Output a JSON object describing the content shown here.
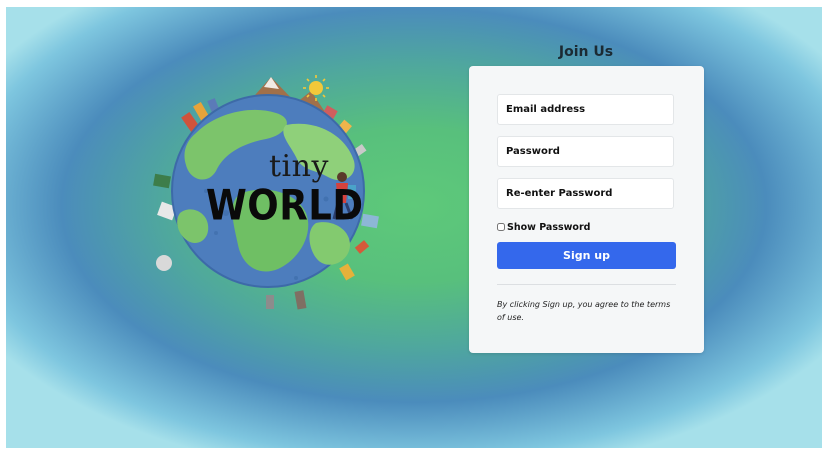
{
  "brand": {
    "line1": "tiny",
    "line2": "WORLD"
  },
  "signup": {
    "title": "Join Us",
    "email_placeholder": "Email address",
    "password_placeholder": "Password",
    "reenter_placeholder": "Re-enter Password",
    "show_password_label": "Show Password",
    "show_password_checked": false,
    "submit_label": "Sign up",
    "terms_text": "By clicking Sign up, you agree to the terms of use."
  },
  "colors": {
    "accent": "#3468ec",
    "card_bg": "#f5f7f8",
    "bg_center": "#5ec97a",
    "bg_edge": "#a6e0ea"
  },
  "icons": {
    "logo": "globe-illustration",
    "sun": "sun-icon"
  }
}
